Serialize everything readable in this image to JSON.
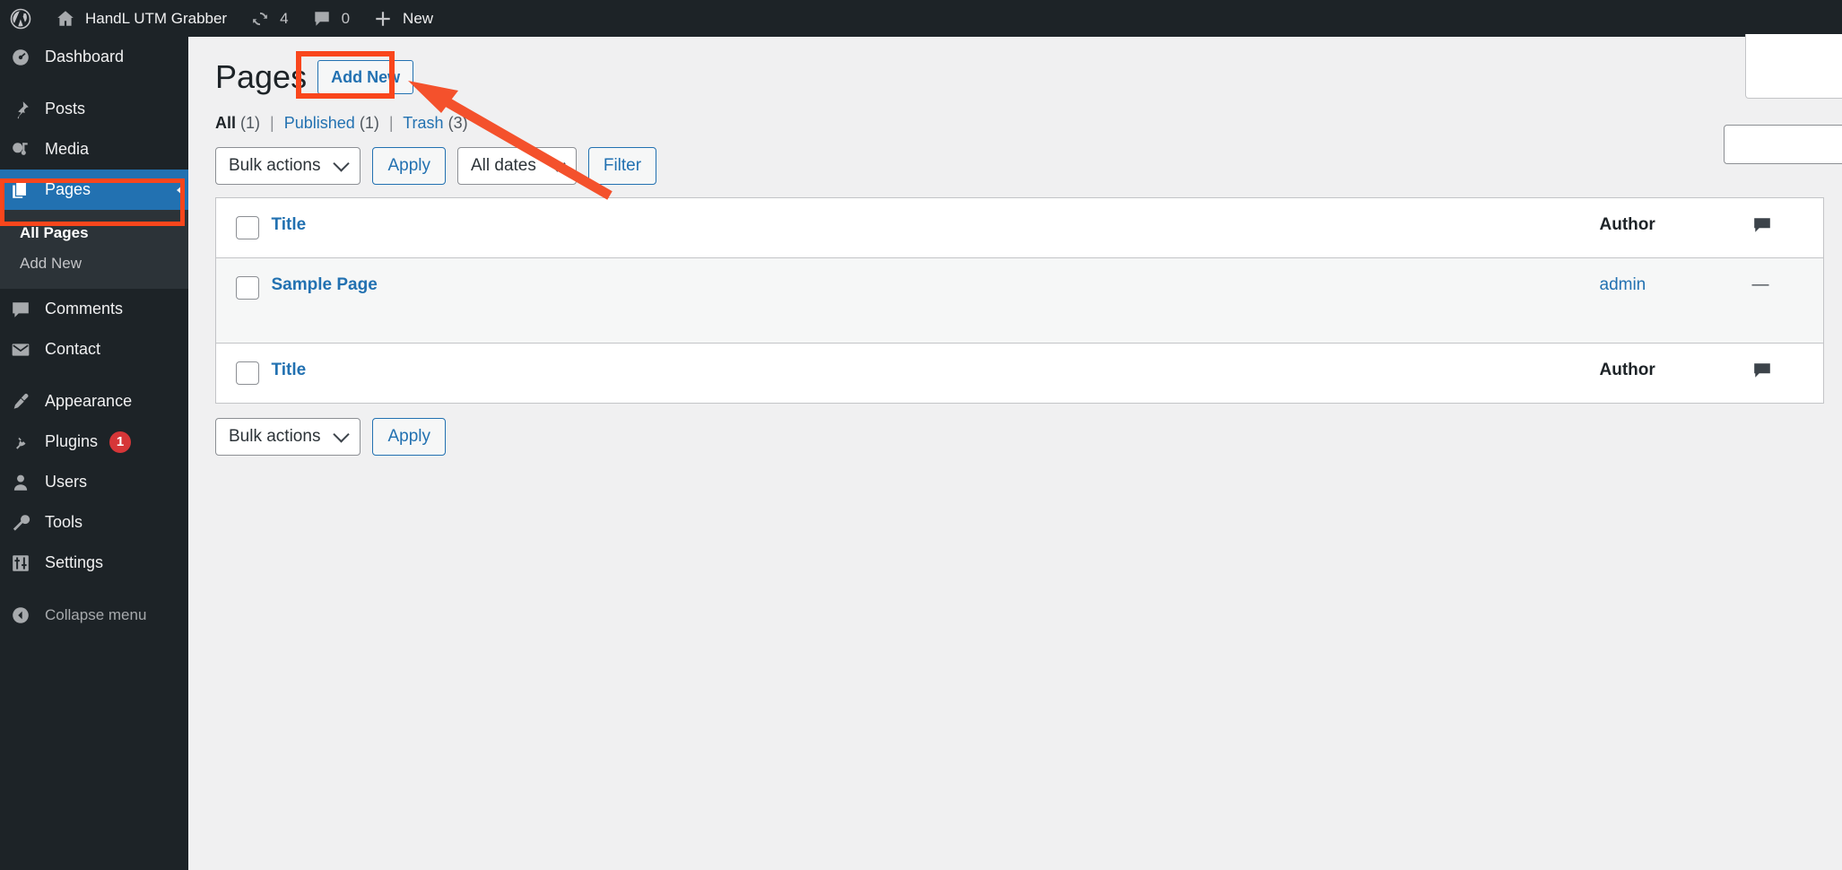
{
  "adminbar": {
    "wp_logo_icon": "wordpress-logo-icon",
    "site_home_icon": "home-icon",
    "site_name": "HandL UTM Grabber",
    "updates_icon": "updates-icon",
    "updates_count": "4",
    "comments_icon": "comment-bubble-icon",
    "comments_count": "0",
    "new_icon": "plus-icon",
    "new_label": "New"
  },
  "sidebar": {
    "items": [
      {
        "label": "Dashboard",
        "icon": "dashboard-gauge-icon",
        "name": "dashboard"
      },
      {
        "label": "Posts",
        "icon": "pin-icon",
        "name": "posts"
      },
      {
        "label": "Media",
        "icon": "media-camera-icon",
        "name": "media"
      },
      {
        "label": "Pages",
        "icon": "pages-icon",
        "name": "pages"
      },
      {
        "label": "Comments",
        "icon": "comment-bubble-icon",
        "name": "comments"
      },
      {
        "label": "Contact",
        "icon": "envelope-icon",
        "name": "contact"
      },
      {
        "label": "Appearance",
        "icon": "paintbrush-icon",
        "name": "appearance"
      },
      {
        "label": "Plugins",
        "icon": "plug-icon",
        "name": "plugins",
        "badge": "1"
      },
      {
        "label": "Users",
        "icon": "user-icon",
        "name": "users"
      },
      {
        "label": "Tools",
        "icon": "wrench-icon",
        "name": "tools"
      },
      {
        "label": "Settings",
        "icon": "settings-sliders-icon",
        "name": "settings"
      }
    ],
    "submenu": [
      {
        "label": "All Pages",
        "active": true
      },
      {
        "label": "Add New",
        "active": false
      }
    ],
    "collapse": {
      "label": "Collapse menu",
      "icon": "collapse-arrow-icon"
    }
  },
  "main": {
    "page_title": "Pages",
    "add_new_label": "Add New",
    "filters": {
      "all_label": "All",
      "all_count": "(1)",
      "published_label": "Published",
      "published_count": "(1)",
      "trash_label": "Trash",
      "trash_count": "(3)",
      "separator": "|"
    },
    "tablenav_top": {
      "bulk_actions_value": "Bulk actions",
      "apply_label": "Apply",
      "dates_value": "All dates",
      "filter_label": "Filter"
    },
    "tablenav_bottom": {
      "bulk_actions_value": "Bulk actions",
      "apply_label": "Apply"
    },
    "table": {
      "columns": {
        "title": "Title",
        "author": "Author",
        "comments_icon": "comment-bubble-icon"
      },
      "rows": [
        {
          "title": "Sample Page",
          "author": "admin",
          "comments": "—"
        }
      ]
    },
    "search_input_value": "",
    "search_input_placeholder": ""
  },
  "annotations": {
    "highlight_color": "#f9461c",
    "arrow_color": "#f4512c",
    "targets": [
      "add-new-button",
      "sidebar-item-pages"
    ]
  },
  "colors": {
    "admin_bar": "#1d2327",
    "sidebar": "#1d2327",
    "current_menu": "#2271b1",
    "link": "#2271b1",
    "badge": "#d63638",
    "content_bg": "#f0f0f1"
  }
}
